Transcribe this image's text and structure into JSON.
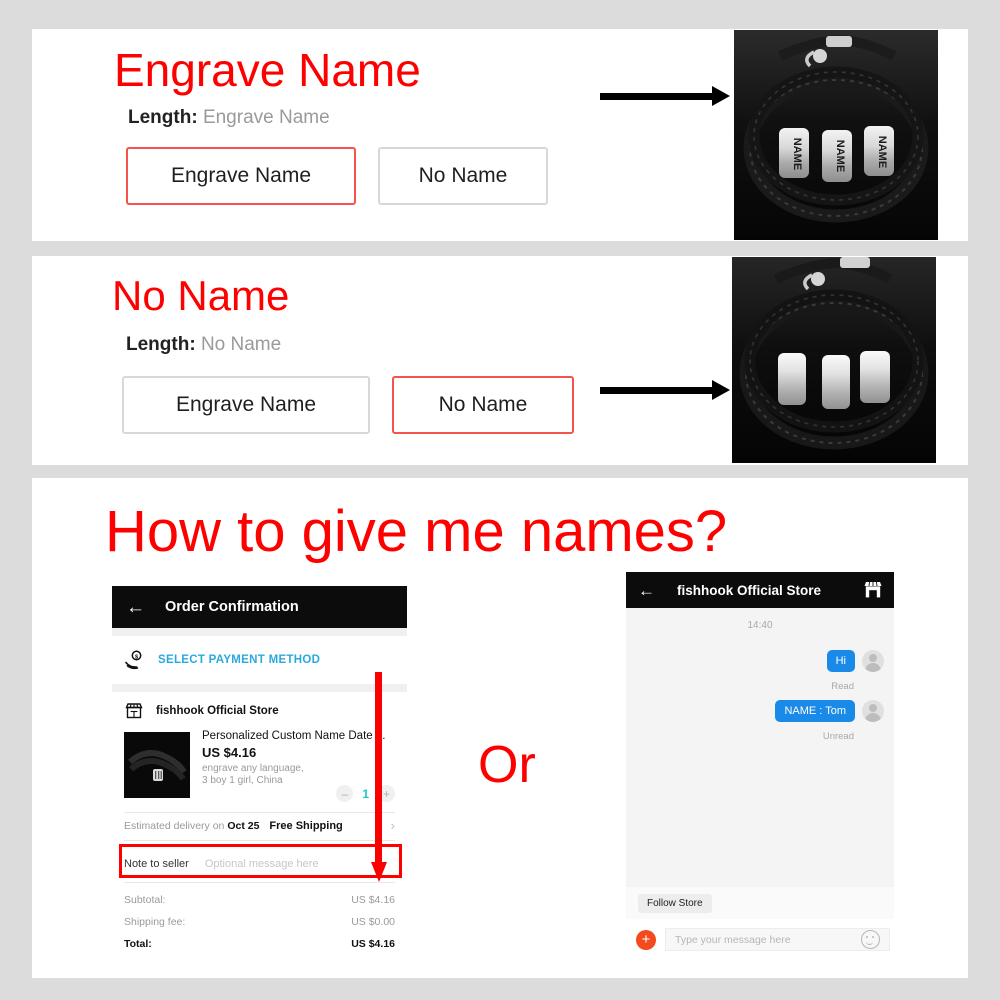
{
  "page": {
    "background_color": "#dcdcdc",
    "panel_color": "#ffffff",
    "accent_red": "#ff0000",
    "selected_border": "#f5544c",
    "link_blue": "#2aa9e0",
    "bubble_blue": "#1a8ae8"
  },
  "panels": [
    {
      "id": "engrave",
      "heading": "Engrave Name",
      "length_label": "Length:",
      "length_value": "Engrave Name",
      "options": [
        {
          "label": "Engrave Name",
          "selected": true
        },
        {
          "label": "No Name",
          "selected": false
        }
      ],
      "arrow": "right-arrow",
      "photo_alt": "black braided leather bracelet with three silver beads engraved NAME",
      "bead_text": "NAME",
      "bead_count": 3
    },
    {
      "id": "noname",
      "heading": "No Name",
      "length_label": "Length:",
      "length_value": "No Name",
      "options": [
        {
          "label": "Engrave Name",
          "selected": false
        },
        {
          "label": "No Name",
          "selected": true
        }
      ],
      "arrow": "right-arrow",
      "photo_alt": "black braided leather bracelet with three blank silver beads",
      "bead_text": "",
      "bead_count": 3
    }
  ],
  "howto": {
    "title": "How to give me  names?",
    "or_text": "Or",
    "order_screen": {
      "title": "Order Confirmation",
      "back_icon": "back-arrow-icon",
      "payment_row": {
        "icon": "hand-coin-icon",
        "label": "SELECT PAYMENT METHOD"
      },
      "store_row": {
        "icon": "storefront-icon",
        "name": "fishhook Official Store"
      },
      "product": {
        "title": "Personalized Custom Name Date ...",
        "price": "US $4.16",
        "attribute_line_1": "engrave any language,",
        "attribute_line_2": "3 boy 1 girl, China",
        "quantity": "1",
        "minus": "–",
        "plus": "+"
      },
      "shipping": {
        "estimated_prefix": "Estimated delivery on ",
        "estimated_date": "Oct 25",
        "free_shipping": "Free Shipping",
        "chevron": "chevron-right-icon"
      },
      "note": {
        "label": "Note to seller",
        "placeholder": "Optional message here",
        "highlighted": true
      },
      "summary": [
        {
          "label": "Subtotal:",
          "value": "US $4.16",
          "emphasis": false
        },
        {
          "label": "Shipping fee:",
          "value": "US $0.00",
          "emphasis": false
        },
        {
          "label": "Total:",
          "value": "US $4.16",
          "emphasis": true
        }
      ],
      "callout_arrow": "red-down-arrow"
    },
    "chat_screen": {
      "title": "fishhook Official Store",
      "back_icon": "back-arrow-icon",
      "store_icon": "storefront-icon",
      "timestamp": "14:40",
      "messages": [
        {
          "text": "Hi",
          "status": "Read",
          "side": "outgoing"
        },
        {
          "text": "NAME : Tom",
          "status": "Unread",
          "side": "outgoing"
        }
      ],
      "follow_button": "Follow Store",
      "composer": {
        "plus_icon": "plus-icon",
        "placeholder": "Type your message here",
        "emoji_icon": "smiley-icon"
      }
    }
  }
}
